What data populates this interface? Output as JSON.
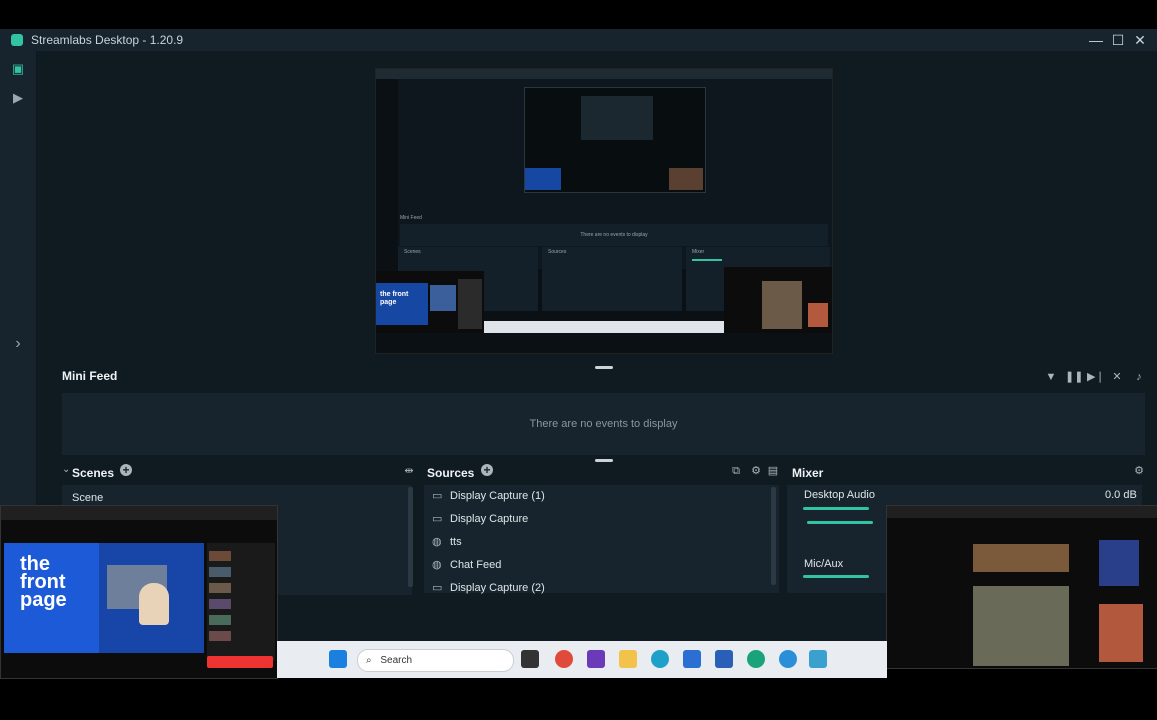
{
  "window": {
    "title": "Streamlabs Desktop - 1.20.9",
    "minimize_glyph": "—",
    "maximize_glyph": "☐",
    "close_glyph": "✕"
  },
  "sidebar": {
    "items": [
      {
        "name": "editor-icon",
        "glyph": "▣"
      },
      {
        "name": "play-icon",
        "glyph": "▶"
      }
    ],
    "expand_glyph": "›"
  },
  "mini_feed": {
    "title": "Mini Feed",
    "empty_text": "There are no events to display",
    "controls": [
      "filter-icon",
      "pause-icon",
      "skip-icon",
      "mute-alerts-icon",
      "volume-icon"
    ]
  },
  "scenes": {
    "title": "Scenes",
    "add_glyph": "+",
    "items": [
      "Scene"
    ]
  },
  "sources": {
    "title": "Sources",
    "add_glyph": "+",
    "items": [
      {
        "label": "Display Capture (1)",
        "icon": "monitor-icon"
      },
      {
        "label": "Display Capture",
        "icon": "monitor-icon"
      },
      {
        "label": "tts",
        "icon": "globe-icon"
      },
      {
        "label": "Chat Feed",
        "icon": "globe-icon"
      },
      {
        "label": "Display Capture (2)",
        "icon": "monitor-icon"
      }
    ]
  },
  "mixer": {
    "title": "Mixer",
    "channels": [
      {
        "label": "Desktop Audio",
        "value": "0.0 dB",
        "level": 0.55
      },
      {
        "label": "Mic/Aux",
        "value": "",
        "level": 0.55
      }
    ]
  },
  "taskbar": {
    "search_placeholder": "Search"
  },
  "overlay_left": {
    "brand_line1": "the",
    "brand_line2": "front",
    "brand_line3": "page"
  },
  "nested_preview": {
    "mini_feed_label": "Mini Feed",
    "no_events": "There are no events to display",
    "scenes_label": "Scenes",
    "sources_label": "Sources",
    "mixer_label": "Mixer",
    "brand": "the front page"
  },
  "colors": {
    "accent": "#31c3a2",
    "panel": "#17242d",
    "background": "#0f1a21"
  }
}
